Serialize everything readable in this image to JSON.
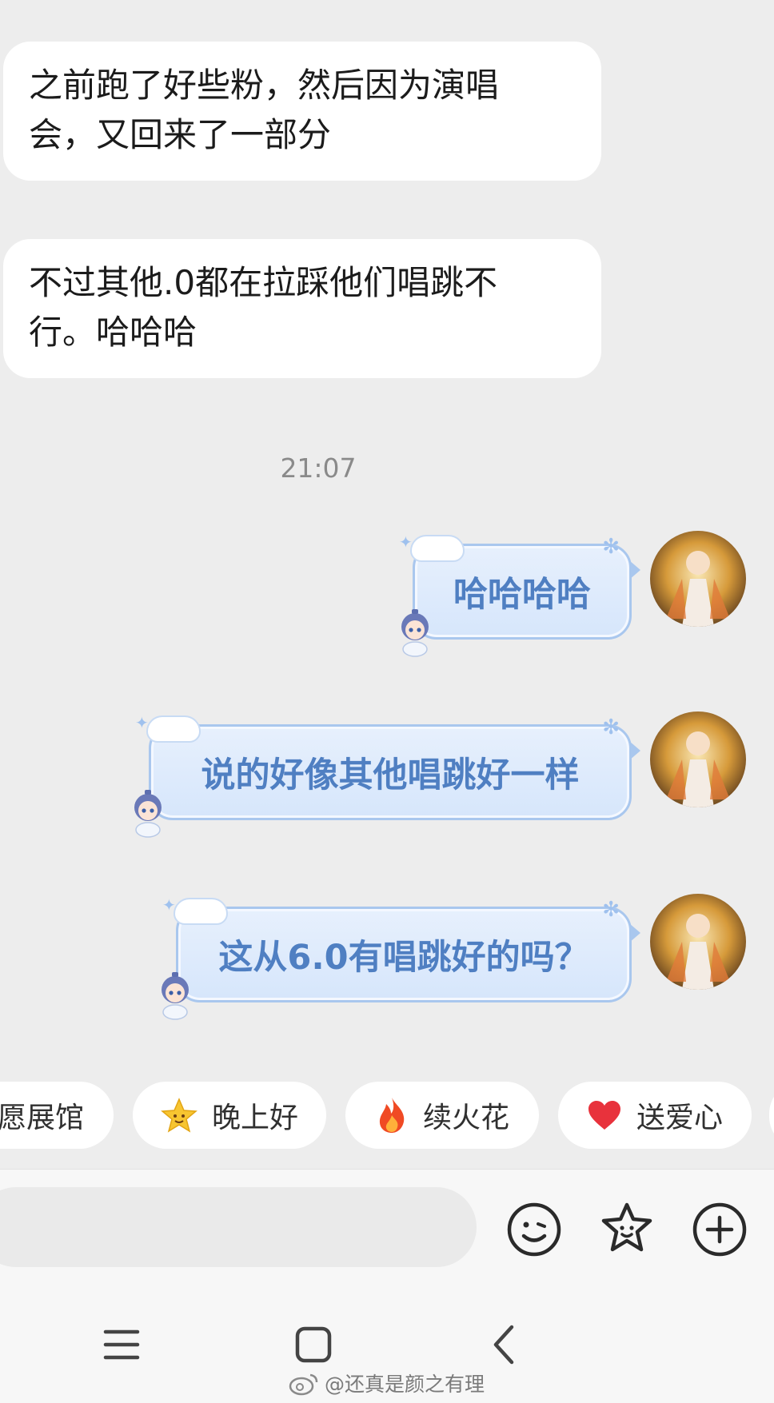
{
  "messages_in": [
    {
      "lines": [
        "之前跑了好些粉，然后因为演唱",
        "会，又回来了一部分"
      ]
    },
    {
      "lines": [
        "不过其他.0都在拉踩他们唱跳不",
        "行。哈哈哈"
      ]
    }
  ],
  "timestamp": "21:07",
  "messages_out": [
    {
      "text": "哈哈哈哈"
    },
    {
      "text": "说的好像其他唱跳好一样"
    },
    {
      "text": "这从6.0有唱跳好的吗？"
    }
  ],
  "quick_replies": [
    {
      "label": "愿展馆",
      "icon": ""
    },
    {
      "label": "晚上好",
      "icon": "star-face-icon"
    },
    {
      "label": "续火花",
      "icon": "flame-icon"
    },
    {
      "label": "送爱心",
      "icon": "heart-icon"
    }
  ],
  "toolbar": {
    "emoji_icon": "emoji-icon",
    "sticker_icon": "sticker-star-icon",
    "plus_icon": "plus-icon"
  },
  "nav": {
    "menu_icon": "menu-icon",
    "home_icon": "home-icon",
    "back_icon": "back-icon"
  },
  "watermark": {
    "text": "@还真是颜之有理",
    "logo": "weibo-logo"
  },
  "colors": {
    "background": "#ededed",
    "incoming_bubble": "#ffffff",
    "outgoing_bubble": "#d6e6fb",
    "outgoing_text": "#4f7fc2",
    "outgoing_border": "#a9c7ee"
  }
}
